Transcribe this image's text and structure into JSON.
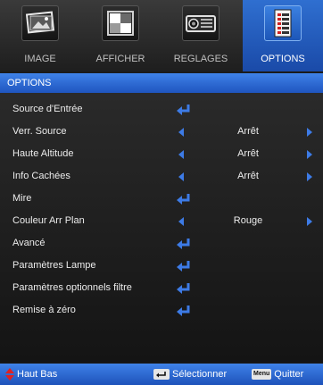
{
  "tabs": [
    {
      "label": "IMAGE",
      "icon": "image-icon",
      "active": false
    },
    {
      "label": "AFFICHER",
      "icon": "display-icon",
      "active": false
    },
    {
      "label": "REGLAGES",
      "icon": "projector-icon",
      "active": false
    },
    {
      "label": "OPTIONS",
      "icon": "options-list-icon",
      "active": true
    }
  ],
  "title": "OPTIONS",
  "menu": [
    {
      "label": "Source d'Entrée",
      "control": "enter"
    },
    {
      "label": "Verr. Source",
      "control": "select",
      "value": "Arrêt"
    },
    {
      "label": "Haute Altitude",
      "control": "select",
      "value": "Arrêt"
    },
    {
      "label": "Info Cachées",
      "control": "select",
      "value": "Arrêt"
    },
    {
      "label": "Mire",
      "control": "enter"
    },
    {
      "label": "Couleur Arr Plan",
      "control": "select",
      "value": "Rouge"
    },
    {
      "label": "Avancé",
      "control": "enter"
    },
    {
      "label": "Paramètres Lampe",
      "control": "enter"
    },
    {
      "label": "Paramètres optionnels filtre",
      "control": "enter"
    },
    {
      "label": "Remise à zéro",
      "control": "enter"
    }
  ],
  "footer": {
    "nav_label": "Haut Bas",
    "select_label": "Sélectionner",
    "menu_key": "Menu",
    "quit_label": "Quitter"
  },
  "colors": {
    "accent": "#2f6fd0",
    "arrow": "#3d7be6",
    "nav_icon": "#e02020"
  }
}
